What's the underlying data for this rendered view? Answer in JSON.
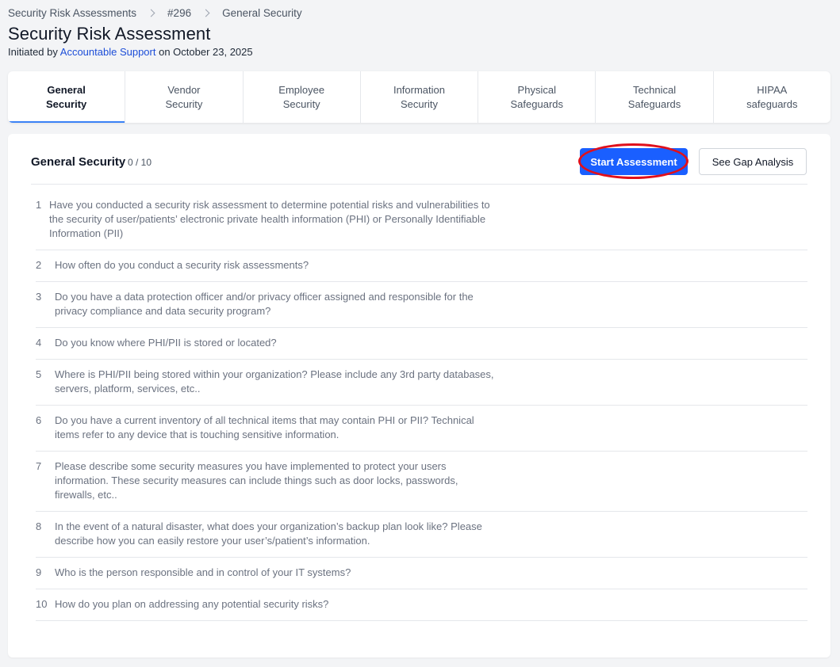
{
  "breadcrumb": {
    "items": [
      "Security Risk Assessments",
      "#296",
      "General Security"
    ]
  },
  "header": {
    "title": "Security Risk Assessment",
    "initiated_prefix": "Initiated by ",
    "initiator": "Accountable Support",
    "initiated_suffix": " on October 23, 2025"
  },
  "tabs": [
    {
      "label": "General\nSecurity",
      "active": true
    },
    {
      "label": "Vendor\nSecurity",
      "active": false
    },
    {
      "label": "Employee\nSecurity",
      "active": false
    },
    {
      "label": "Information\nSecurity",
      "active": false
    },
    {
      "label": "Physical\nSafeguards",
      "active": false
    },
    {
      "label": "Technical\nSafeguards",
      "active": false
    },
    {
      "label": "HIPAA\nsafeguards",
      "active": false
    }
  ],
  "section": {
    "title": "General Security",
    "count": "0 / 10",
    "start_label": "Start Assessment",
    "gap_label": "See Gap Analysis"
  },
  "questions": [
    {
      "num": "1",
      "text": "Have you conducted a security risk assessment to determine potential risks and vulnerabilities to the security of user/patients’ electronic private health information (PHI) or Personally Identifiable Information (PII)"
    },
    {
      "num": "2",
      "text": "How often do you conduct a security risk assessments?"
    },
    {
      "num": "3",
      "text": "Do you have a data protection officer and/or privacy officer assigned and responsible for the privacy compliance and data security program?"
    },
    {
      "num": "4",
      "text": "Do you know where PHI/PII is stored or located?"
    },
    {
      "num": "5",
      "text": "Where is PHI/PII being stored within your organization? Please include any 3rd party databases, servers, platform, services, etc.."
    },
    {
      "num": "6",
      "text": "Do you have a current inventory of all technical items that may contain PHI or PII? Technical items refer to any device that is touching sensitive information."
    },
    {
      "num": "7",
      "text": "Please describe some security measures you have implemented to protect your users information. These security measures can include things such as door locks, passwords, firewalls, etc.."
    },
    {
      "num": "8",
      "text": "In the event of a natural disaster, what does your organization’s backup plan look like? Please describe how you can easily restore your user’s/patient’s information."
    },
    {
      "num": "9",
      "text": "Who is the person responsible and in control of your IT systems?"
    },
    {
      "num": "10",
      "text": "How do you plan on addressing any potential security risks?"
    }
  ],
  "colors": {
    "accent": "#1a5fff",
    "link": "#1d4ed8",
    "highlight": "#e0101c"
  }
}
